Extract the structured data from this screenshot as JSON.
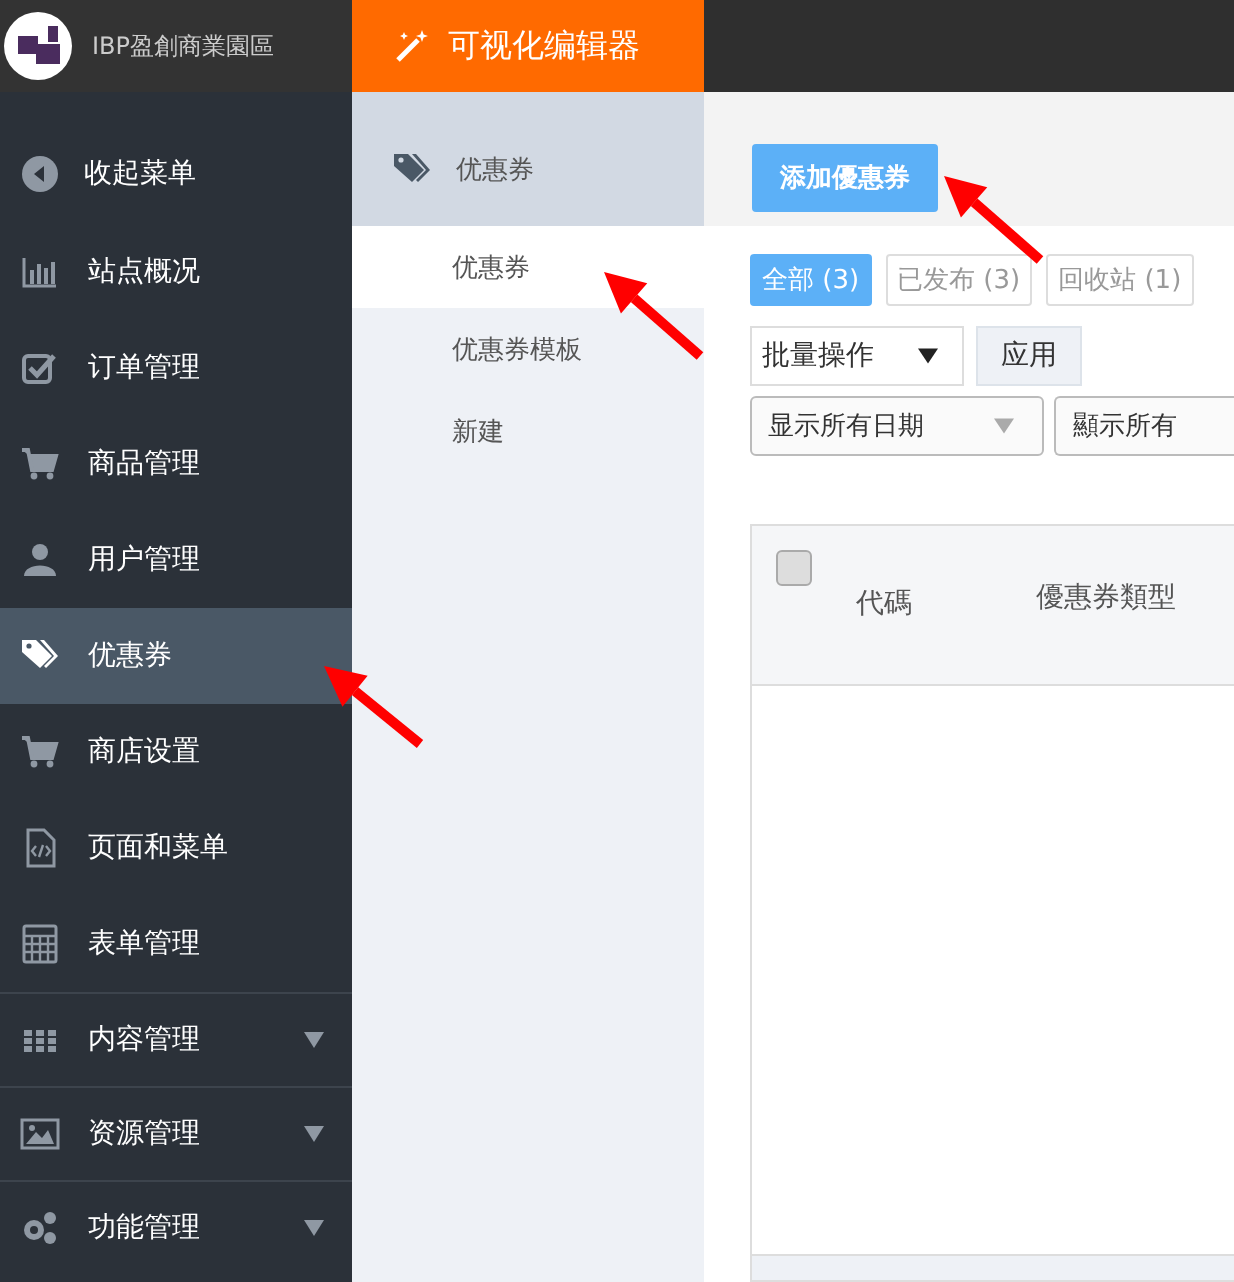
{
  "topbar": {
    "site_name": "IBP盈創商業園區",
    "editor_tab": "可视化编辑器"
  },
  "sidebar": {
    "collapse_label": "收起菜单",
    "items": [
      {
        "label": "站点概况",
        "selected": false,
        "expandable": false
      },
      {
        "label": "订单管理",
        "selected": false,
        "expandable": false
      },
      {
        "label": "商品管理",
        "selected": false,
        "expandable": false
      },
      {
        "label": "用户管理",
        "selected": false,
        "expandable": false
      },
      {
        "label": "优惠券",
        "selected": true,
        "expandable": false
      },
      {
        "label": "商店设置",
        "selected": false,
        "expandable": false
      },
      {
        "label": "页面和菜单",
        "selected": false,
        "expandable": false
      },
      {
        "label": "表单管理",
        "selected": false,
        "expandable": false
      },
      {
        "label": "内容管理",
        "selected": false,
        "expandable": true
      },
      {
        "label": "资源管理",
        "selected": false,
        "expandable": true
      },
      {
        "label": "功能管理",
        "selected": false,
        "expandable": true
      }
    ]
  },
  "submenu": {
    "title": "优惠券",
    "items": [
      {
        "label": "优惠券",
        "selected": true
      },
      {
        "label": "优惠券模板",
        "selected": false
      },
      {
        "label": "新建",
        "selected": false
      }
    ]
  },
  "main": {
    "add_button": "添加優惠券",
    "filters": [
      {
        "label": "全部 (3)",
        "selected": true
      },
      {
        "label": "已发布 (3)",
        "selected": false
      },
      {
        "label": "回收站 (1)",
        "selected": false
      }
    ],
    "bulk_action": "批量操作",
    "apply_button": "应用",
    "date_filter": "显示所有日期",
    "type_filter": "顯示所有",
    "table": {
      "select_all_checked": false,
      "columns": [
        "代碼",
        "優惠券類型"
      ]
    }
  }
}
